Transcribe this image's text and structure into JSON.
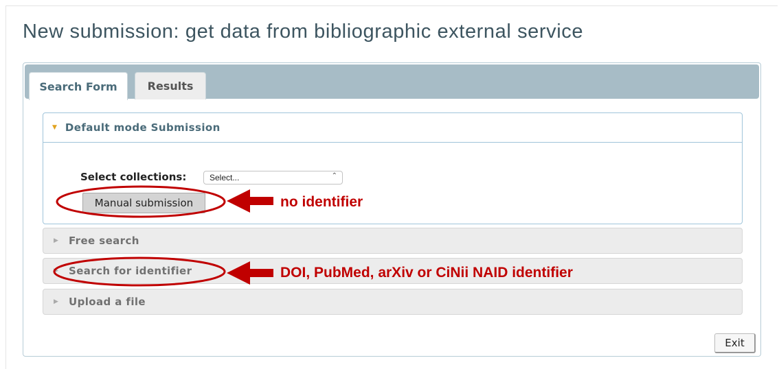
{
  "page": {
    "title": "New submission: get data from bibliographic external service"
  },
  "tabs": [
    {
      "label": "Search Form",
      "active": true
    },
    {
      "label": "Results",
      "active": false
    }
  ],
  "default_panel": {
    "label": "Default mode Submission",
    "collections_label": "Select collections:",
    "collections_select_value": "Select...",
    "manual_button_label": "Manual submission"
  },
  "panels": [
    {
      "label": "Free search"
    },
    {
      "label": "Search for identifier"
    },
    {
      "label": "Upload a file"
    }
  ],
  "footer": {
    "exit_label": "Exit"
  },
  "annotations": {
    "manual_note": "no identifier",
    "identifier_note": "DOI, PubMed, arXiv or CiNii NAID identifier",
    "color": "#c00000"
  },
  "colors": {
    "title": "#3d5560",
    "tab_bar": "#a7bcc6",
    "panel_border_active": "#9fc4da",
    "accent_arrow": "#e2a31f"
  },
  "icons": {
    "panel_expanded": "triangle-down-icon",
    "panel_collapsed": "triangle-right-icon",
    "select_chevron": "updown-chevron-icon",
    "annotation_arrow": "red-arrow-icon"
  }
}
